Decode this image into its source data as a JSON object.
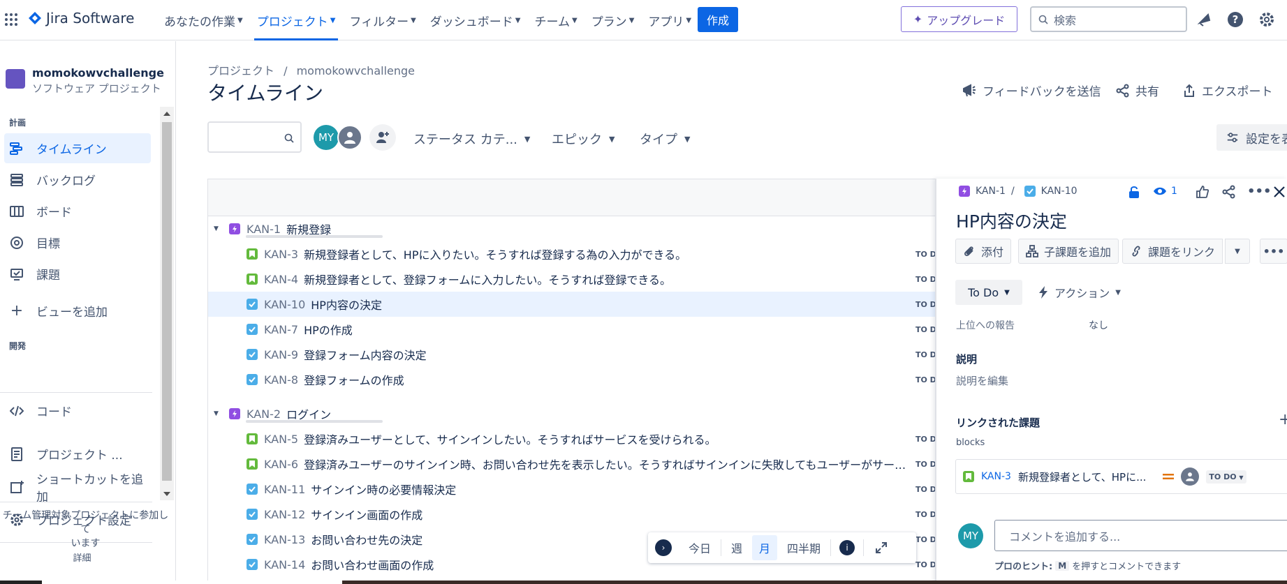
{
  "topnav": {
    "logo": "Jira Software",
    "items": [
      {
        "label": "あなたの作業"
      },
      {
        "label": "プロジェクト"
      },
      {
        "label": "フィルター"
      },
      {
        "label": "ダッシュボード"
      },
      {
        "label": "チーム"
      },
      {
        "label": "プラン"
      },
      {
        "label": "アプリ"
      }
    ],
    "create": "作成",
    "upgrade": "アップグレード",
    "search_placeholder": "検索"
  },
  "sidebar": {
    "project_name": "momokowvchallenge",
    "project_type": "ソフトウェア プロジェクト",
    "section_plan": "計画",
    "plan_items": [
      "タイムライン",
      "バックログ",
      "ボード",
      "目標",
      "課題"
    ],
    "add_view": "ビューを追加",
    "section_dev": "開発",
    "code": "コード",
    "project_pages": "プロジェクト ...",
    "add_shortcut": "ショートカットを追加",
    "project_settings": "プロジェクト設定",
    "footer_line1": "チーム管理対象プロジェクトに参加して",
    "footer_line2": "います",
    "detail": "詳細"
  },
  "main": {
    "breadcrumb_root": "プロジェクト",
    "breadcrumb_sep": "/",
    "breadcrumb_project": "momokowvchallenge",
    "title": "タイムライン",
    "feedback": "フィードバックを送信",
    "share": "共有",
    "export": "エクスポート",
    "avatar_initials": "MY",
    "filter_status": "ステータス カテ...",
    "filter_epic": "エピック",
    "filter_type": "タイプ",
    "settings": "設定を表"
  },
  "timeline": {
    "rows": [
      {
        "kind": "epic",
        "key": "KAN-1",
        "summary": "新規登録",
        "status": ""
      },
      {
        "kind": "story",
        "key": "KAN-3",
        "summary": "新規登録者として、HPに入りたい。そうすれば登録する為の入力ができる。",
        "status": "TO D"
      },
      {
        "kind": "story",
        "key": "KAN-4",
        "summary": "新規登録者として、登録フォームに入力したい。そうすれば登録できる。",
        "status": "TO D"
      },
      {
        "kind": "task",
        "key": "KAN-10",
        "summary": "HP内容の決定",
        "status": "TO D",
        "selected": true
      },
      {
        "kind": "task",
        "key": "KAN-7",
        "summary": "HPの作成",
        "status": "TO D"
      },
      {
        "kind": "task",
        "key": "KAN-9",
        "summary": "登録フォーム内容の決定",
        "status": "TO D"
      },
      {
        "kind": "task",
        "key": "KAN-8",
        "summary": "登録フォームの作成",
        "status": "TO D"
      },
      {
        "kind": "epic",
        "key": "KAN-2",
        "summary": "ログイン",
        "status": ""
      },
      {
        "kind": "story",
        "key": "KAN-5",
        "summary": "登録済みユーザーとして、サインインしたい。そうすればサービスを受けられる。",
        "status": "TO D"
      },
      {
        "kind": "story",
        "key": "KAN-6",
        "summary": "登録済みユーザーのサインイン時、お問い合わせ先を表示したい。そうすればサインインに失敗してもユーザーがサービ...",
        "status": "TO D"
      },
      {
        "kind": "task",
        "key": "KAN-11",
        "summary": "サインイン時の必要情報決定",
        "status": "TO D"
      },
      {
        "kind": "task",
        "key": "KAN-12",
        "summary": "サインイン画面の作成",
        "status": "TO D"
      },
      {
        "kind": "task",
        "key": "KAN-13",
        "summary": "お問い合わせ先の決定",
        "status": "TO D"
      },
      {
        "kind": "task",
        "key": "KAN-14",
        "summary": "お問い合わせ画面の作成",
        "status": "TO D"
      }
    ],
    "zoom": {
      "today": "今日",
      "week": "週",
      "month": "月",
      "quarter": "四半期"
    }
  },
  "panel": {
    "parent_key": "KAN-1",
    "sep": "/",
    "issue_key": "KAN-10",
    "watch_count": "1",
    "title": "HP内容の決定",
    "attach": "添付",
    "add_child": "子課題を追加",
    "link_issue": "課題をリンク",
    "status": "To Do",
    "action": "アクション",
    "report_label": "上位への報告",
    "report_value": "なし",
    "desc_heading": "説明",
    "desc_edit": "説明を編集",
    "linked_heading": "リンクされた課題",
    "link_type": "blocks",
    "linked_key": "KAN-3",
    "linked_summary": "新規登録者として、HPに...",
    "linked_status": "TO DO",
    "comment_initials": "MY",
    "comment_placeholder": "コメントを追加する...",
    "tip_prefix": "プロのヒント:",
    "tip_key": "M",
    "tip_suffix": "を押すとコメントできます"
  },
  "colors": {
    "accent": "#0c66e4",
    "story": "#63ba3c",
    "task": "#4bade8",
    "epic": "#904ee2",
    "avatar": "#1d9aaa"
  }
}
